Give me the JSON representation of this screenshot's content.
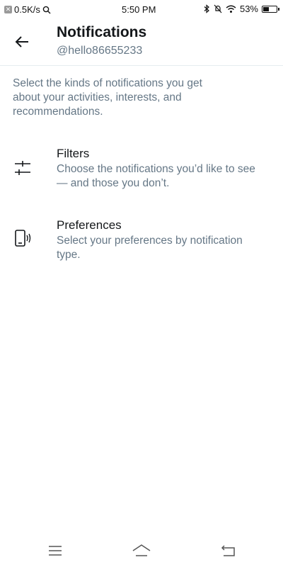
{
  "status_bar": {
    "speed": "0.5K/s",
    "time": "5:50 PM",
    "battery": "53%",
    "battery_level": 0.53
  },
  "header": {
    "title": "Notifications",
    "handle": "@hello86655233"
  },
  "intro": "Select the kinds of notifications you get about your activities, interests, and recommendations.",
  "options": [
    {
      "icon": "filter-icon",
      "title": "Filters",
      "description": "Choose the notifications you’d like to see — and those you don’t."
    },
    {
      "icon": "phone-sound-icon",
      "title": "Preferences",
      "description": "Select your preferences by notification type."
    }
  ],
  "nav": {
    "icons": [
      "menu-icon",
      "home-icon",
      "back-icon"
    ]
  }
}
